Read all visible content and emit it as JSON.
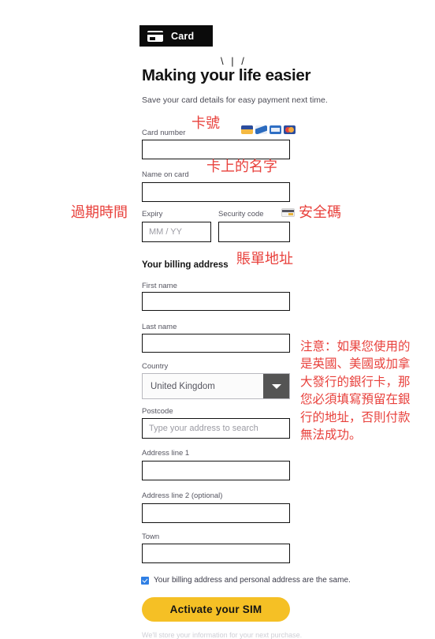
{
  "tab": {
    "label": "Card",
    "icon": "credit-card-icon"
  },
  "hero": {
    "sparkle": "\\ | /",
    "title": "Making your life easier",
    "subtitle": "Save your card details for easy payment next time."
  },
  "card_section": {
    "card_number": {
      "label": "Card number",
      "value": "",
      "placeholder": ""
    },
    "brands": [
      "visa-icon",
      "maestro-icon",
      "amex-icon",
      "mastercard-icon"
    ],
    "name_on_card": {
      "label": "Name on card",
      "value": "",
      "placeholder": ""
    },
    "expiry": {
      "label": "Expiry",
      "value": "",
      "placeholder": "MM / YY"
    },
    "security_code": {
      "label": "Security code",
      "value": "",
      "placeholder": "",
      "icon": "cvv-card-icon"
    }
  },
  "billing": {
    "heading": "Your billing address",
    "first_name": {
      "label": "First name",
      "value": "",
      "placeholder": ""
    },
    "last_name": {
      "label": "Last name",
      "value": "",
      "placeholder": ""
    },
    "country": {
      "label": "Country",
      "value": "United Kingdom",
      "options": [
        "United Kingdom"
      ]
    },
    "postcode": {
      "label": "Postcode",
      "value": "",
      "placeholder": "Type your address to search"
    },
    "address_line_1": {
      "label": "Address line 1",
      "value": "",
      "placeholder": ""
    },
    "address_line_2": {
      "label": "Address line 2 (optional)",
      "value": "",
      "placeholder": ""
    },
    "town": {
      "label": "Town",
      "value": "",
      "placeholder": ""
    }
  },
  "same_address": {
    "checked": true,
    "label": "Your billing address and personal address are the same."
  },
  "submit": {
    "label": "Activate your SIM"
  },
  "footnote": "We'll store your information for your next purchase.",
  "annotations": {
    "card_number": "卡號",
    "name_on_card": "卡上的名字",
    "expiry": "過期時間",
    "security_code": "安全碼",
    "billing_address": "賬單地址",
    "note": "注意：如果您使用的是英國、美國或加拿大發行的銀行卡，那您必須填寫預留在銀行的地址，否則付款無法成功。"
  },
  "colors": {
    "tab_background": "#0b0b0b",
    "annotation_red": "#e8413c",
    "cta_yellow": "#f5c025",
    "checkbox_blue": "#2f7fe4",
    "select_arrow_gray": "#545454"
  }
}
